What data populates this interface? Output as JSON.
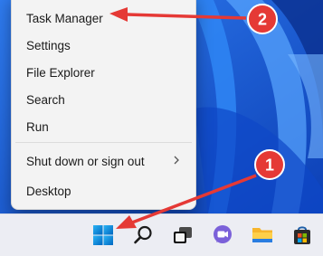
{
  "context_menu": {
    "items": [
      {
        "label": "Task Manager"
      },
      {
        "label": "Settings"
      },
      {
        "label": "File Explorer"
      },
      {
        "label": "Search"
      },
      {
        "label": "Run"
      },
      {
        "label": "Shut down or sign out",
        "has_submenu": true
      },
      {
        "label": "Desktop"
      }
    ]
  },
  "taskbar": {
    "icons": [
      "windows-start-icon",
      "search-icon",
      "task-view-icon",
      "teams-chat-icon",
      "file-explorer-icon",
      "microsoft-store-icon"
    ]
  },
  "annotations": {
    "step1": "1",
    "step2": "2",
    "color": "#e53935"
  },
  "colors": {
    "wallpaper": "#1c5bd6",
    "menu_background": "#f3f3f3",
    "taskbar_background": "#ecedf3",
    "accent": "#0078d4"
  }
}
